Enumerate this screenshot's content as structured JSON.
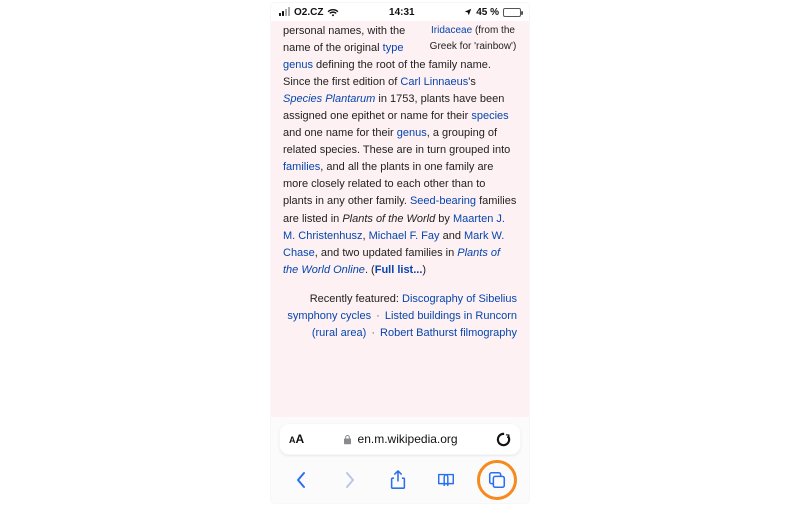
{
  "status": {
    "carrier": "O2.CZ",
    "time": "14:31",
    "battery_text": "45 %"
  },
  "side_note": {
    "link": "Iridaceae",
    "tail": "(from the Greek for 'rainbow')"
  },
  "article": {
    "t0": "personal names, with the name of the original ",
    "l_type": "type genus",
    "t1": " defining the root of the family name. Since the first edition of ",
    "l_linnaeus": "Carl Linnaeus",
    "t2": "'s ",
    "l_species_plantarum": "Species Plantarum",
    "t3": " in 1753, plants have been assigned one epithet or name for their ",
    "l_species": "species",
    "t4": " and one name for their ",
    "l_genus": "genus",
    "t5": ", a grouping of related species. These are in turn grouped into ",
    "l_families": "families",
    "t6": ", and all the plants in one family are more closely related to each other than to plants in any other family. ",
    "l_seed": "Seed-bearing",
    "t7": " families are listed in ",
    "i_pow": "Plants of the World",
    "t8": " by ",
    "l_chr": "Maarten J. M. Christenhusz",
    "t9": ", ",
    "l_fay": "Michael F. Fay",
    "t10": " and ",
    "l_chase": "Mark W. Chase",
    "t11": ", and two updated families in ",
    "l_powo": "Plants of the World Online",
    "t12": ". (",
    "l_full": "Full list...",
    "t13": ")"
  },
  "recent": {
    "label": "Recently featured: ",
    "l1": "Discography of Sibelius symphony cycles",
    "l2": "Listed buildings in Runcorn (rural area)",
    "l3": "Robert Bathurst filmography"
  },
  "url": {
    "domain": "en.m.wikipedia.org"
  },
  "arrow": "↗"
}
